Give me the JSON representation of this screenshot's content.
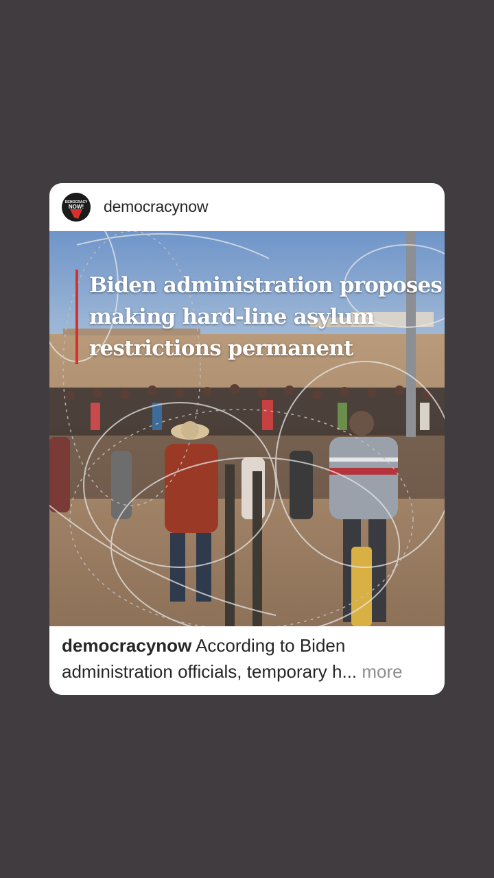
{
  "post": {
    "username": "democracynow",
    "avatar_icon": "democracy-now-logo-icon",
    "image_headline": [
      "Biden administration proposes",
      "making hard-line asylum",
      "restrictions permanent"
    ],
    "caption_user": "democracynow",
    "caption_line1": "According to Biden",
    "caption_line2": "administration officials, temporary h...",
    "more_label": "more",
    "accent_color": "#d92f2a"
  },
  "logo_text": "DEMOCRACY NOW!"
}
